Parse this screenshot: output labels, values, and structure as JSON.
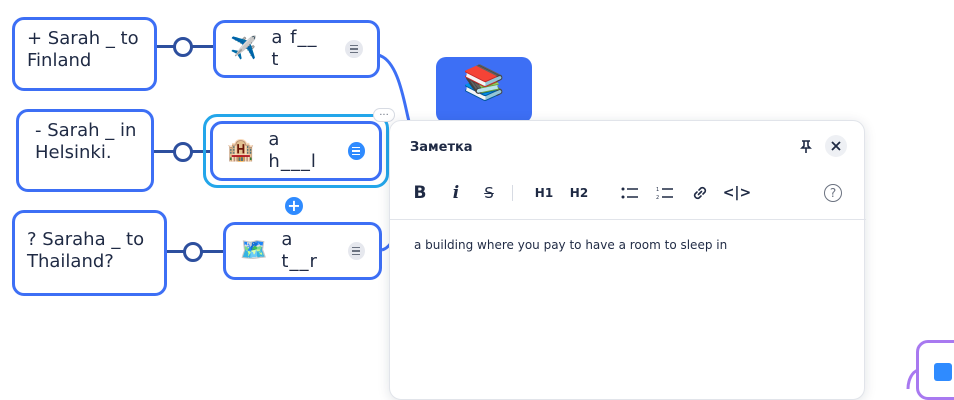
{
  "left_nodes": [
    {
      "text": "+ Sarah _ to Finland"
    },
    {
      "text": "- Sarah _ in Helsinki."
    },
    {
      "text": "? Saraha _ to Thailand?"
    }
  ],
  "chips": [
    {
      "emoji": "✈️",
      "icon": "airplane-icon",
      "label": "a f__ t"
    },
    {
      "emoji": "🏨",
      "icon": "hotel-icon",
      "label": "a h___l"
    },
    {
      "emoji": "🗺️",
      "icon": "map-icon",
      "label": "a t__r"
    }
  ],
  "book_tile": {
    "emoji": "📚",
    "icon": "books-icon"
  },
  "note_panel": {
    "title": "Заметка",
    "toolbar": {
      "bold": "B",
      "italic": "i",
      "strike": "S",
      "h1": "H1",
      "h2": "H2",
      "bullet_icon": "bullet-list-icon",
      "numbered_icon": "numbered-list-icon",
      "link_icon": "link-icon",
      "code": "<|>",
      "help": "?"
    },
    "content": "a building where you pay to have a room to sleep in"
  },
  "colors": {
    "node_border": "#3d6ff5",
    "connector": "#2d4f9e",
    "selection": "#23a6ea",
    "accent": "#2f8bff",
    "purple": "#a879f0"
  }
}
